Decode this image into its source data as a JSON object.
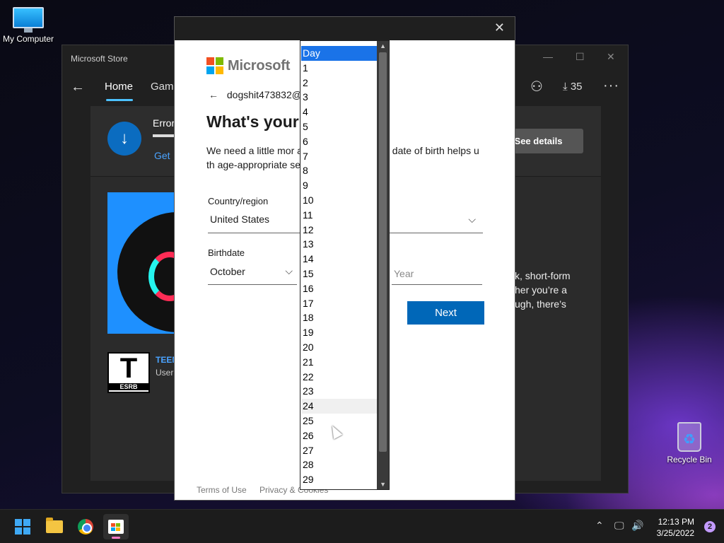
{
  "desktop": {
    "icons": [
      {
        "label": "My Computer"
      },
      {
        "label": "Recycle Bin"
      }
    ]
  },
  "store": {
    "title": "Microsoft Store",
    "nav": {
      "home": "Home",
      "gaming": "Gami",
      "downloads_count": "35"
    },
    "error_banner": {
      "title": "Error",
      "link": "Get",
      "button": "See details"
    },
    "description_lines": [
      "k, short-form",
      "her you’re a",
      "ugh, there’s"
    ],
    "rating": {
      "letter": "T",
      "brand": "ESRB",
      "label": "TEEN",
      "sub": "User"
    }
  },
  "dialog": {
    "brand": "Microsoft",
    "account": "dogshit473832@",
    "heading": "What's your",
    "body": "We need a little mor                             an use this app. Your date of birth helps u                      th age-appropriate settings.",
    "country_label": "Country/region",
    "country_value": "United States",
    "birthdate_label": "Birthdate",
    "month_value": "October",
    "year_placeholder": "Year",
    "next_label": "Next",
    "footer": {
      "terms": "Terms of Use",
      "privacy": "Privacy & Cookies"
    }
  },
  "day_dropdown": {
    "selected": "Day",
    "hovered": "24",
    "options": [
      "Day",
      "1",
      "2",
      "3",
      "4",
      "5",
      "6",
      "7",
      "8",
      "9",
      "10",
      "11",
      "12",
      "13",
      "14",
      "15",
      "16",
      "17",
      "18",
      "19",
      "20",
      "21",
      "22",
      "23",
      "24",
      "25",
      "26",
      "27",
      "28",
      "29"
    ]
  },
  "taskbar": {
    "time": "12:13 PM",
    "date": "3/25/2022",
    "notifications": "2"
  },
  "colors": {
    "accent_blue": "#0067b8",
    "dropdown_selected": "#1a73e8",
    "store_link": "#4aa3ff",
    "ms_red": "#f25022",
    "ms_green": "#7fba00",
    "ms_blue": "#00a4ef",
    "ms_yellow": "#ffb900"
  }
}
